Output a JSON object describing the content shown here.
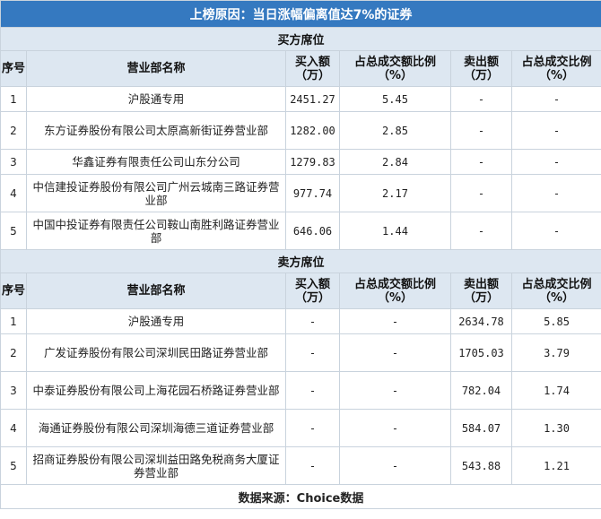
{
  "title": "上榜原因：当日涨幅偏离值达7%的证券",
  "buy_section": {
    "label": "买方席位",
    "headers": [
      "序号",
      "营业部名称",
      "买入额（万）",
      "占总成交额比例（%）",
      "卖出额（万）",
      "占总成交比例（%）"
    ],
    "rows": [
      {
        "idx": "1",
        "name": "沪股通专用",
        "buy": "2451.27",
        "buy_pct": "5.45",
        "sell": "-",
        "sell_pct": "-"
      },
      {
        "idx": "2",
        "name": "东方证券股份有限公司太原高新街证券营业部",
        "buy": "1282.00",
        "buy_pct": "2.85",
        "sell": "-",
        "sell_pct": "-"
      },
      {
        "idx": "3",
        "name": "华鑫证券有限责任公司山东分公司",
        "buy": "1279.83",
        "buy_pct": "2.84",
        "sell": "-",
        "sell_pct": "-"
      },
      {
        "idx": "4",
        "name": "中信建投证券股份有限公司广州云城南三路证券营业部",
        "buy": "977.74",
        "buy_pct": "2.17",
        "sell": "-",
        "sell_pct": "-"
      },
      {
        "idx": "5",
        "name": "中国中投证券有限责任公司鞍山南胜利路证券营业部",
        "buy": "646.06",
        "buy_pct": "1.44",
        "sell": "-",
        "sell_pct": "-"
      }
    ]
  },
  "sell_section": {
    "label": "卖方席位",
    "headers": [
      "序号",
      "营业部名称",
      "买入额（万）",
      "占总成交额比例（%）",
      "卖出额（万）",
      "占总成交比例（%）"
    ],
    "rows": [
      {
        "idx": "1",
        "name": "沪股通专用",
        "buy": "-",
        "buy_pct": "-",
        "sell": "2634.78",
        "sell_pct": "5.85"
      },
      {
        "idx": "2",
        "name": "广发证券股份有限公司深圳民田路证券营业部",
        "buy": "-",
        "buy_pct": "-",
        "sell": "1705.03",
        "sell_pct": "3.79"
      },
      {
        "idx": "3",
        "name": "中泰证券股份有限公司上海花园石桥路证券营业部",
        "buy": "-",
        "buy_pct": "-",
        "sell": "782.04",
        "sell_pct": "1.74"
      },
      {
        "idx": "4",
        "name": "海通证券股份有限公司深圳海德三道证券营业部",
        "buy": "-",
        "buy_pct": "-",
        "sell": "584.07",
        "sell_pct": "1.30"
      },
      {
        "idx": "5",
        "name": "招商证券股份有限公司深圳益田路免税商务大厦证券营业部",
        "buy": "-",
        "buy_pct": "-",
        "sell": "543.88",
        "sell_pct": "1.21"
      }
    ]
  },
  "footer": "数据来源：Choice数据"
}
